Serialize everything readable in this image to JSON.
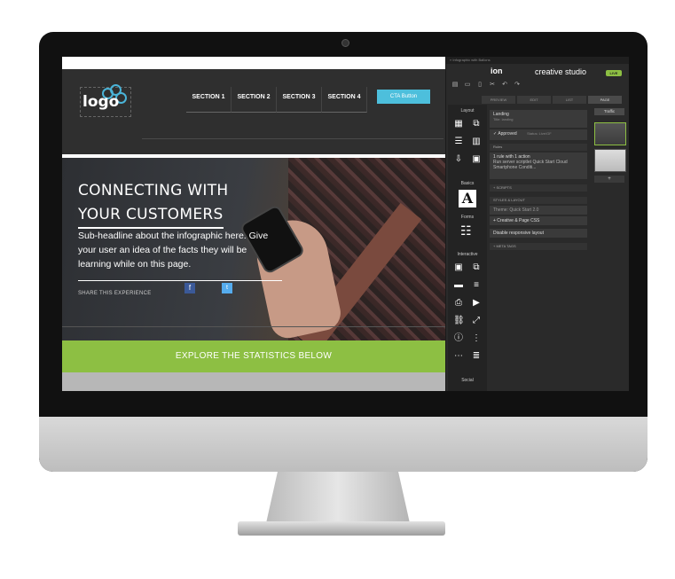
{
  "site": {
    "logo_text": "logo",
    "nav": [
      "SECTION 1",
      "SECTION 2",
      "SECTION 3",
      "SECTION 4"
    ],
    "cta_label": "CTA Button",
    "hero": {
      "title_line1": "CONNECTING WITH",
      "title_line2": "YOUR CUSTOMERS",
      "subheadline": "Sub-headline about the infographic here. Give your user an idea of the facts they will be learning while on this page.",
      "share_label": "SHARE THIS EXPERIENCE",
      "facebook_glyph": "f",
      "twitter_glyph": "t"
    },
    "explore_label": "EXPLORE THE STATISTICS BELOW"
  },
  "builder": {
    "top_path": "» Infographic with Ballons",
    "brand": "ion",
    "title": "creative studio",
    "live_badge": "LIVE",
    "tabs": [
      "PREVIEW",
      "EDIT",
      "LIST",
      "PAGE",
      "OVERVIEW"
    ],
    "active_tab": "PAGE",
    "components": {
      "layout_label": "Layout",
      "basics_label": "Basics",
      "basics_glyph": "A",
      "forms_label": "Forms",
      "interactive_label": "Interactive",
      "social_label": "Social"
    },
    "props": {
      "page_name": "Landing",
      "page_name_sub": "Title: landing",
      "approved": "Approved",
      "approved_note": "Status: Live/GF",
      "rules_header": "Rules",
      "rule_title": "1 rule with 1 action",
      "rule_detail": "Run server scriptlet Quick Start Cloud Smartphone Conditi...",
      "scripts_header": "+ SCRIPTS",
      "styles_header": "STYLES & LAYOUT",
      "theme": "Theme: Quick Start 2.0",
      "css": "+ Creative & Page CSS",
      "responsive": "Disable responsive layout",
      "meta_header": "+ META TAGS"
    },
    "thumbs": {
      "traffic_tab": "Traffic",
      "add": "+"
    }
  }
}
